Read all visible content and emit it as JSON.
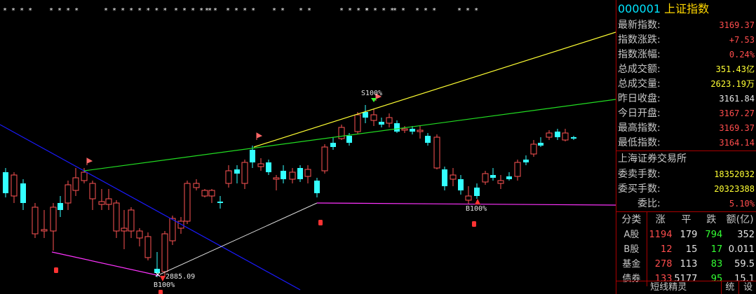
{
  "top_markers": [
    "* * * *",
    "* * * *",
    "* * * * * * * *",
    "* * * * *",
    "* *",
    "* * * *",
    "* *",
    "* *",
    "* * * *",
    "* * * *",
    "* *",
    "* * *",
    "* * *"
  ],
  "chart": {
    "low_label": "2885.09",
    "low_marker_label": "B100%",
    "mid_marker_label": "B100%",
    "sell_label": "S100%",
    "colors": {
      "up": "#ff5555",
      "down": "#33ffff",
      "blue_line": "#1a1aff",
      "yellow_line": "#ffff33",
      "green_line": "#22dd22",
      "white_line": "#dddddd",
      "magenta_line": "#ff33ff"
    }
  },
  "panel": {
    "code": "000001",
    "name": "上证指数",
    "rows": [
      {
        "label": "最新指数:",
        "value": "3169.37",
        "color": "red"
      },
      {
        "label": "指数涨跌:",
        "value": "+7.53",
        "color": "red"
      },
      {
        "label": "指数涨幅:",
        "value": "0.24%",
        "color": "red"
      },
      {
        "label": "总成交额:",
        "value": "351.43亿",
        "color": "yellow"
      },
      {
        "label": "总成交量:",
        "value": "2623.19万",
        "color": "yellow"
      },
      {
        "label": "昨日收盘:",
        "value": "3161.84",
        "color": "white"
      },
      {
        "label": "今日开盘:",
        "value": "3167.27",
        "color": "red"
      },
      {
        "label": "最高指数:",
        "value": "3169.37",
        "color": "red"
      },
      {
        "label": "最低指数:",
        "value": "3164.14",
        "color": "red"
      }
    ],
    "exchange": "上海证券交易所",
    "rows2": [
      {
        "label": "委卖手数:",
        "value": "18352032",
        "color": "yellow"
      },
      {
        "label": "委买手数:",
        "value": "20323388",
        "color": "yellow"
      },
      {
        "label": "委比:",
        "value": "5.10%",
        "color": "red"
      }
    ],
    "table": {
      "headers": [
        "分类",
        "涨",
        "平",
        "跌",
        "额(亿)"
      ],
      "rows": [
        {
          "cat": "A股",
          "up": "1194",
          "flat": "179",
          "down": "794",
          "amt": "352"
        },
        {
          "cat": "B股",
          "up": "12",
          "flat": "15",
          "down": "17",
          "amt": "0.011"
        },
        {
          "cat": "基金",
          "up": "278",
          "flat": "113",
          "down": "83",
          "amt": "59.5"
        },
        {
          "cat": "债券",
          "up": "133",
          "flat": "5177",
          "down": "95",
          "amt": "15.1"
        }
      ]
    },
    "footer": {
      "left": "短线精灵",
      "mid": "统",
      "right": "设"
    }
  }
}
